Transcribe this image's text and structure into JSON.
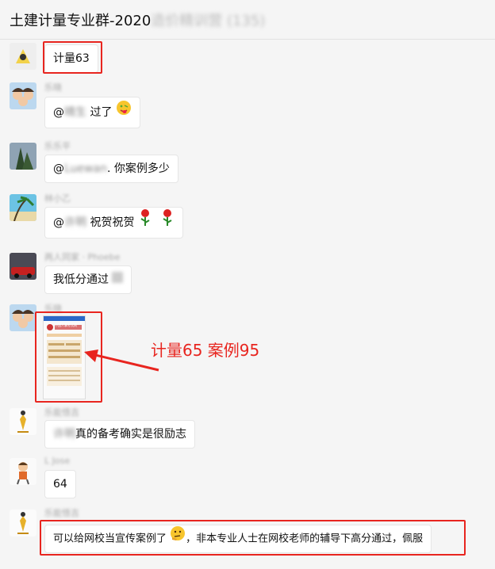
{
  "header": {
    "title": "土建计量专业群-2020",
    "title_blurred": "造价精训营 (135)"
  },
  "messages": [
    {
      "sender": "",
      "text": "计量63",
      "highlighted": true
    },
    {
      "sender": "乐晓",
      "prefix": "@",
      "blurred": "晴生",
      "text": "过了",
      "icon": "winking-tongue-emoji"
    },
    {
      "sender": "乐乐平",
      "prefix": "@",
      "blurred": "Luewan",
      "text": ". 你案例多少"
    },
    {
      "sender": "林小乙",
      "prefix": "@",
      "blurred": "许明",
      "text": "祝贺祝贺",
      "icon": "rose-emoji"
    },
    {
      "sender": "两人同家 · Phoebe",
      "text": "我低分通过",
      "icon": "blurred-emoji"
    },
    {
      "sender": "乐晓",
      "image": "score-screenshot",
      "highlighted": true
    },
    {
      "sender": "乐能悟吉",
      "blurred": "许明",
      "text": "真的备考确实是很励志"
    },
    {
      "sender": "L Jose",
      "text": "64"
    },
    {
      "sender": "乐能悟吉",
      "text": "可以给网校当宣传案例了",
      "text2": "，非本专业人士在网校老师的辅导下高分通过，佩服",
      "icon": "thinking-emoji",
      "highlighted": true
    }
  ],
  "annotation": {
    "text": "计量65  案例95",
    "color": "#e8251f"
  },
  "image_caption": "中国人事考试网"
}
